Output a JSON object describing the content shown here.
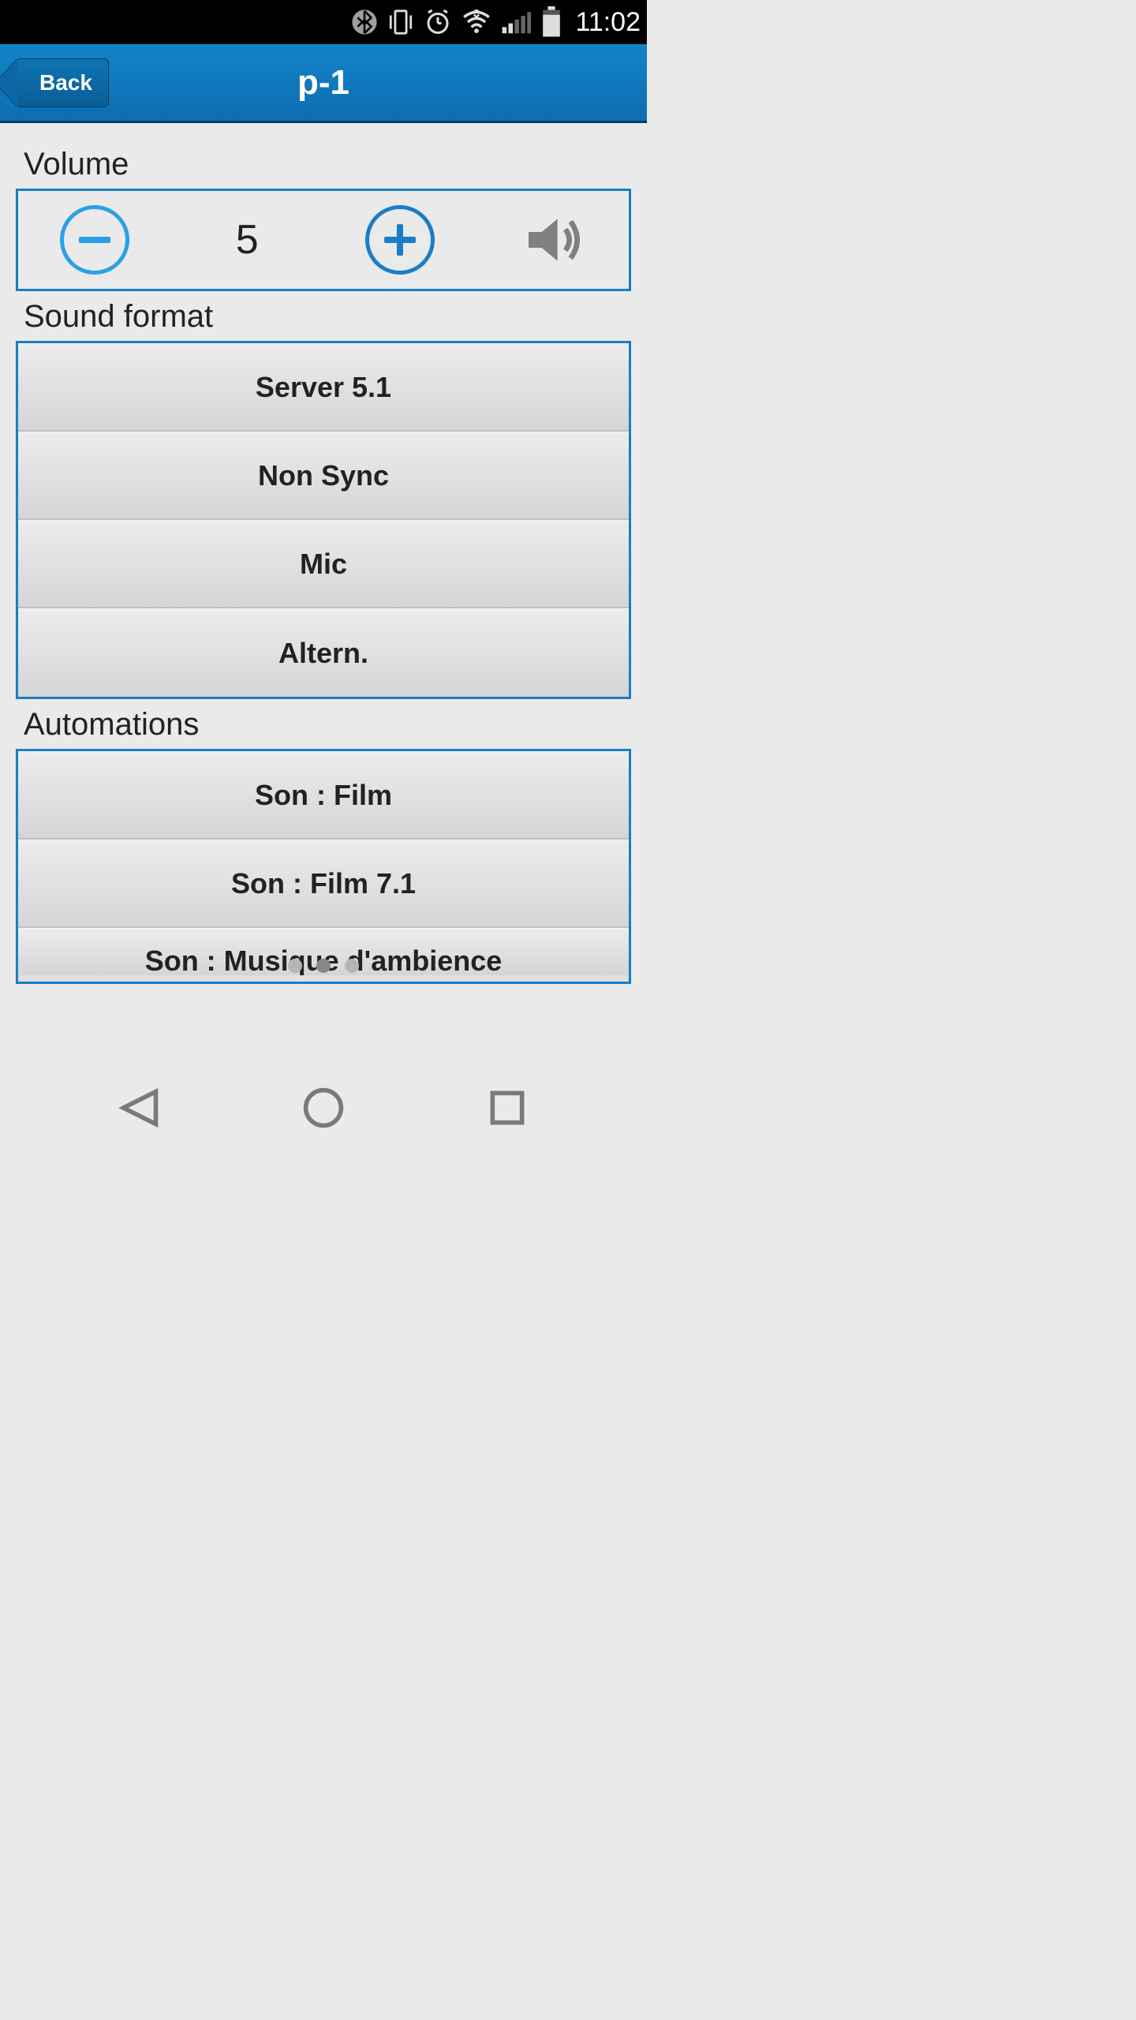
{
  "status": {
    "time": "11:02"
  },
  "header": {
    "back_label": "Back",
    "title": "p-1"
  },
  "volume": {
    "label": "Volume",
    "value": "5"
  },
  "sound_format": {
    "label": "Sound format",
    "items": [
      "Server 5.1",
      "Non Sync",
      "Mic",
      "Altern."
    ]
  },
  "automations": {
    "label": "Automations",
    "items": [
      "Son : Film",
      "Son : Film 7.1",
      "Son : Musique d'ambience"
    ]
  },
  "pagination": {
    "count": 3,
    "active": 1
  }
}
